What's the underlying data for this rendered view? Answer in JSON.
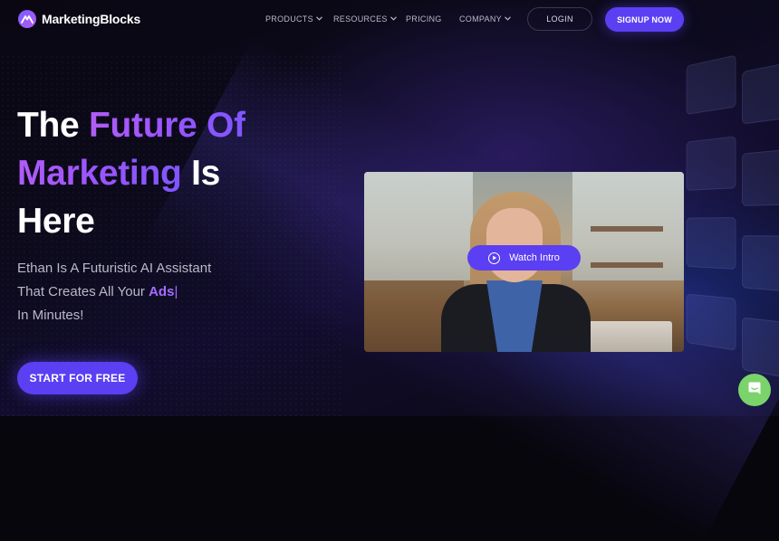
{
  "brand": {
    "name": "MarketingBlocks"
  },
  "nav": {
    "items": [
      {
        "label": "PRODUCTS",
        "has_dropdown": true
      },
      {
        "label": "RESOURCES",
        "has_dropdown": true
      },
      {
        "label": "PRICING",
        "has_dropdown": false
      },
      {
        "label": "COMPANY",
        "has_dropdown": true
      }
    ],
    "login_label": "LOGIN",
    "signup_label": "SIGNUP NOW"
  },
  "hero": {
    "headline": {
      "line1_white": "The",
      "line1_purple": "Future Of",
      "line2_purple": "Marketing",
      "line2_white": "Is",
      "line3_white": "Here"
    },
    "subtitle": {
      "line1": "Ethan Is A Futuristic AI Assistant",
      "line2_prefix": "That Creates All Your",
      "line2_highlight": "Ads",
      "line2_caret": "|",
      "line3": "In Minutes!"
    },
    "cta_label": "START FOR FREE"
  },
  "video": {
    "watch_label": "Watch Intro"
  },
  "icons": {
    "logo": "mountain-logo-icon",
    "dropdown": "chevron-down-icon",
    "play": "play-circle-icon",
    "chat": "chat-bubble-icon"
  },
  "colors": {
    "accent": "#5b3ff2",
    "headline_gradient_start": "#b05cf7",
    "headline_gradient_end": "#7e56ff",
    "highlight": "#a66cff",
    "chat": "#7bd36b",
    "background": "#07060d"
  }
}
